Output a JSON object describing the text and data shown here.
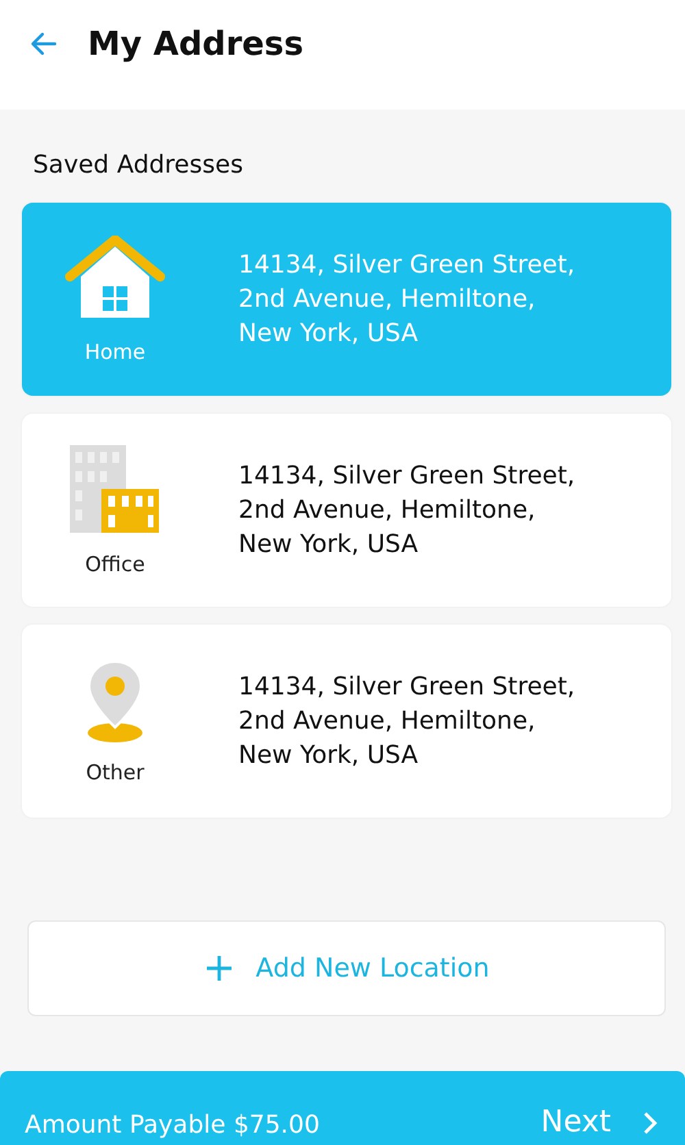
{
  "header": {
    "title": "My Address"
  },
  "section_title": "Saved Addresses",
  "addresses": [
    {
      "kind": "home",
      "label": "Home",
      "lines": [
        "14134, Silver Green Street,",
        "2nd Avenue, Hemiltone,",
        "New York, USA"
      ],
      "selected": true
    },
    {
      "kind": "office",
      "label": "Office",
      "lines": [
        "14134, Silver Green Street,",
        "2nd Avenue, Hemiltone,",
        "New York, USA"
      ],
      "selected": false
    },
    {
      "kind": "other",
      "label": "Other",
      "lines": [
        "14134, Silver Green Street,",
        "2nd Avenue, Hemiltone,",
        "New York, USA"
      ],
      "selected": false
    }
  ],
  "add_button": {
    "label": "Add New Location"
  },
  "footer": {
    "amount": "Amount Payable $75.00",
    "next": "Next"
  }
}
